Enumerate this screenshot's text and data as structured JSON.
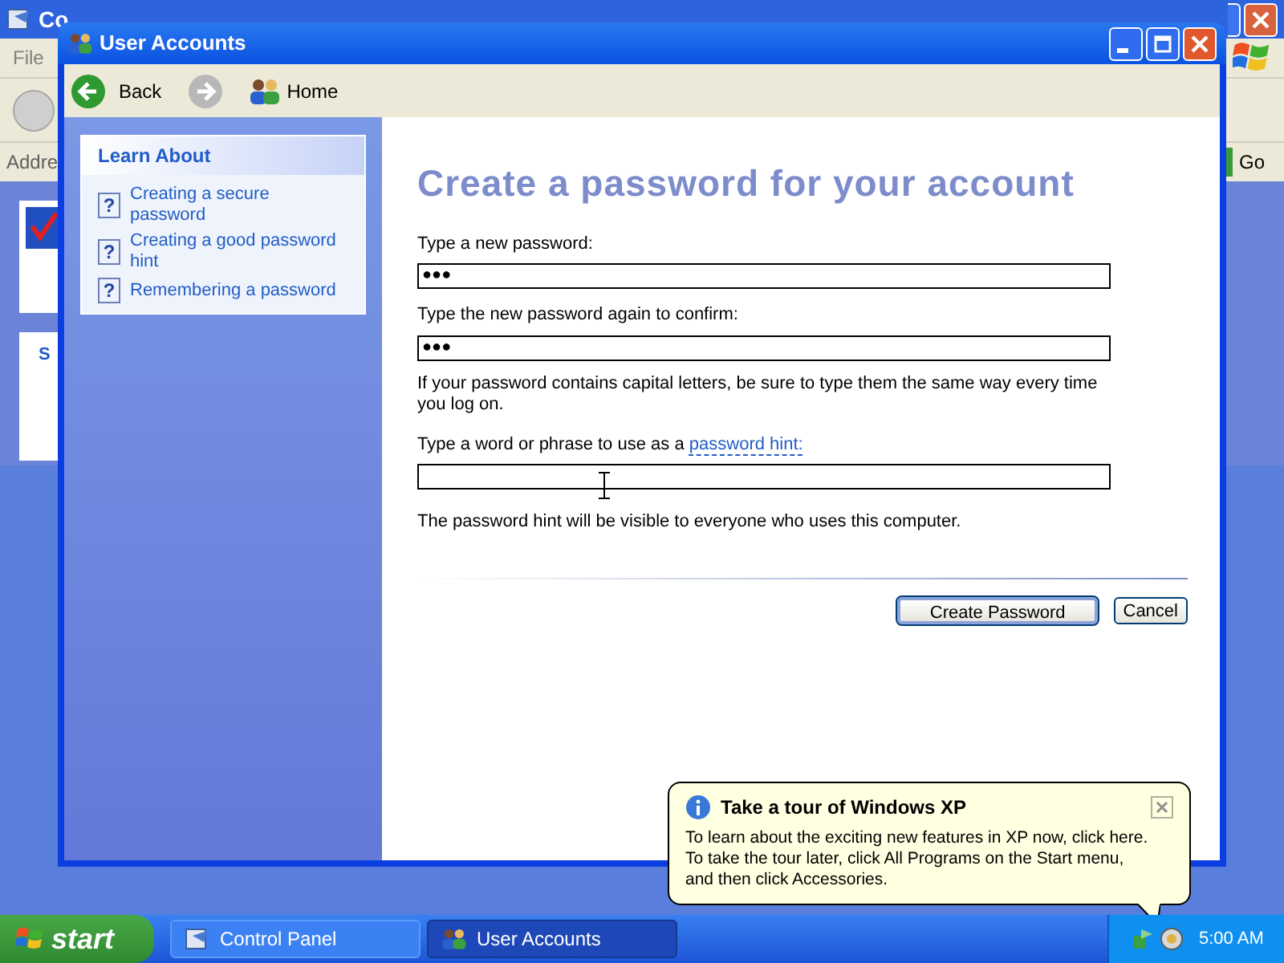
{
  "background_window": {
    "title": "Co",
    "menu": [
      "File"
    ],
    "address_label": "Addre",
    "go_button": "Go",
    "panel_heading": "S"
  },
  "window": {
    "title": "User Accounts"
  },
  "toolbar": {
    "back": "Back",
    "home": "Home"
  },
  "learn_about": {
    "heading": "Learn About",
    "items": [
      {
        "icon": "?",
        "label": "Creating a secure password"
      },
      {
        "icon": "?",
        "label": "Creating a good password hint"
      },
      {
        "icon": "?",
        "label": "Remembering a password"
      }
    ]
  },
  "form": {
    "heading": "Create a password for your account",
    "fields": [
      {
        "label": "Type a new password:",
        "value": "●●●"
      },
      {
        "label": "Type the new password again to confirm:",
        "value": "●●●"
      }
    ],
    "caps_note": "If your password contains capital letters, be sure to type them the same way every time you log on.",
    "hint_label": "Type a word or phrase to use as a",
    "hint_link": "password hint:",
    "hint_note": "The password hint will be visible to everyone who uses this computer.",
    "buttons": [
      {
        "label": "Create Password",
        "default": true
      },
      {
        "label": "Cancel",
        "default": false
      }
    ]
  },
  "balloon": {
    "title": "Take a tour of Windows XP",
    "lines": [
      "To learn about the exciting new features in XP now, click here.",
      "To take the tour later, click All Programs on the Start menu,",
      "and then click Accessories."
    ]
  },
  "taskbar": {
    "start": "start",
    "tasks": [
      {
        "label": "Control Panel",
        "selected": false
      },
      {
        "label": "User Accounts",
        "selected": true
      }
    ],
    "clock": "5:00 AM"
  }
}
